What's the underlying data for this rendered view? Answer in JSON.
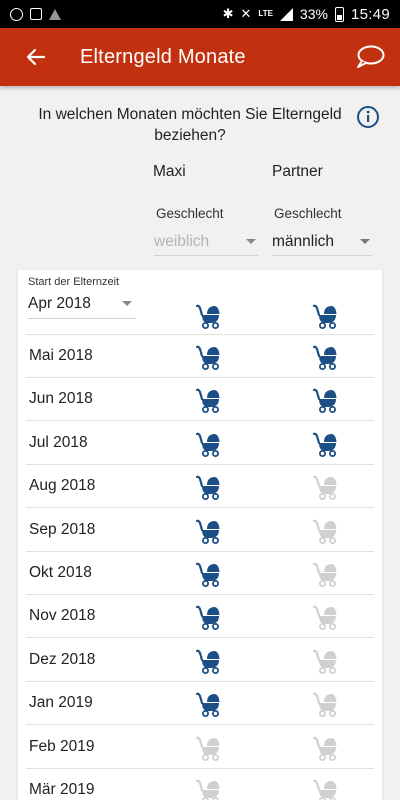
{
  "status_bar": {
    "network": "LTE",
    "battery": "33%",
    "time": "15:49"
  },
  "app_bar": {
    "title": "Elterngeld Monate",
    "back_icon": "arrow-left-icon",
    "chat_icon": "chat-bubble-icon"
  },
  "question": "In welchen Monaten möchten Sie Elterngeld beziehen?",
  "columns": {
    "parent1": {
      "name": "Maxi",
      "gender_label": "Geschlecht",
      "gender_value": "weiblich",
      "gender_enabled": false
    },
    "parent2": {
      "name": "Partner",
      "gender_label": "Geschlecht",
      "gender_value": "männlich",
      "gender_enabled": true
    }
  },
  "start_label": "Start der Elternzeit",
  "colors": {
    "accent": "#c2310f",
    "stroller_active": "#1b4f85",
    "stroller_inactive": "#d0d0d0"
  },
  "months": [
    {
      "label": "Apr 2018",
      "p1": true,
      "p2": true
    },
    {
      "label": "Mai 2018",
      "p1": true,
      "p2": true
    },
    {
      "label": "Jun 2018",
      "p1": true,
      "p2": true
    },
    {
      "label": "Jul 2018",
      "p1": true,
      "p2": true
    },
    {
      "label": "Aug 2018",
      "p1": true,
      "p2": false
    },
    {
      "label": "Sep 2018",
      "p1": true,
      "p2": false
    },
    {
      "label": "Okt 2018",
      "p1": true,
      "p2": false
    },
    {
      "label": "Nov 2018",
      "p1": true,
      "p2": false
    },
    {
      "label": "Dez 2018",
      "p1": true,
      "p2": false
    },
    {
      "label": "Jan 2019",
      "p1": true,
      "p2": false
    },
    {
      "label": "Feb 2019",
      "p1": false,
      "p2": false
    },
    {
      "label": "Mär 2019",
      "p1": false,
      "p2": false
    }
  ]
}
